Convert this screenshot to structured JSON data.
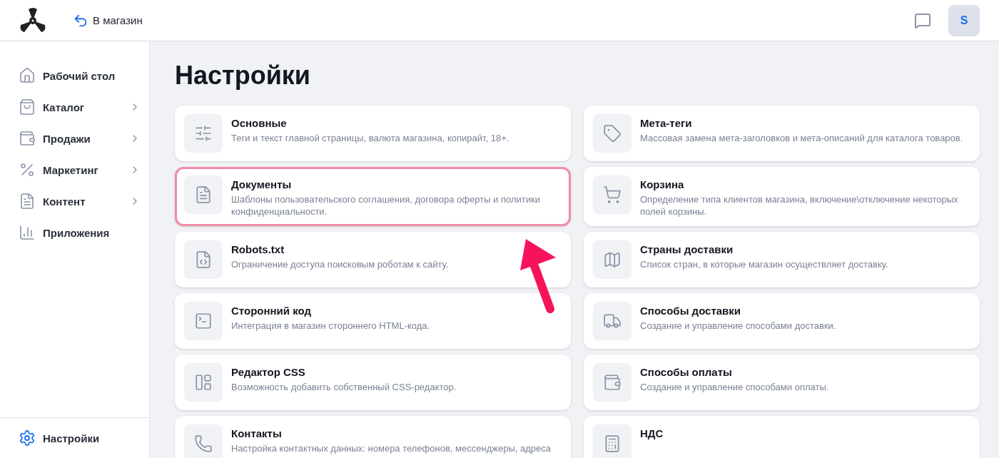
{
  "header": {
    "back_link": "В магазин",
    "avatar": "S"
  },
  "sidebar": {
    "items": [
      {
        "label": "Рабочий стол",
        "has_submenu": false,
        "selected": false
      },
      {
        "label": "Каталог",
        "has_submenu": true,
        "selected": false
      },
      {
        "label": "Продажи",
        "has_submenu": true,
        "selected": false
      },
      {
        "label": "Маркетинг",
        "has_submenu": true,
        "selected": false
      },
      {
        "label": "Контент",
        "has_submenu": true,
        "selected": false
      },
      {
        "label": "Приложения",
        "has_submenu": false,
        "selected": false
      }
    ],
    "footer_item": {
      "label": "Настройки",
      "selected": true
    }
  },
  "page": {
    "title": "Настройки",
    "columns": [
      [
        {
          "title": "Основные",
          "description": "Теги и текст главной страницы, валюта магазина, копирайт, 18+.",
          "highlighted": false
        },
        {
          "title": "Документы",
          "description": "Шаблоны пользовательского соглашения, договора оферты и политики конфиденциальности.",
          "highlighted": true
        },
        {
          "title": "Robots.txt",
          "description": "Ограничение доступа поисковым роботам к сайту.",
          "highlighted": false
        },
        {
          "title": "Сторонний код",
          "description": "Интеграция в магазин стороннего HTML-кода.",
          "highlighted": false
        },
        {
          "title": "Редактор CSS",
          "description": "Возможность добавить собственный CSS-редактор.",
          "highlighted": false
        },
        {
          "title": "Контакты",
          "description": "Настройка контактных данных: номера телефонов, мессенджеры, адреса",
          "highlighted": false
        }
      ],
      [
        {
          "title": "Мета-теги",
          "description": "Массовая замена мета-заголовков и мета-описаний для каталога товаров.",
          "highlighted": false
        },
        {
          "title": "Корзина",
          "description": "Определение типа клиентов магазина, включение\\отключение некоторых полей корзины.",
          "highlighted": false
        },
        {
          "title": "Страны доставки",
          "description": "Список стран, в которые магазин осуществляет доставку.",
          "highlighted": false
        },
        {
          "title": "Способы доставки",
          "description": "Создание и управление способами доставки.",
          "highlighted": false
        },
        {
          "title": "Способы оплаты",
          "description": "Создание и управление способами оплаты.",
          "highlighted": false
        },
        {
          "title": "НДС",
          "highlighted": false
        }
      ]
    ]
  }
}
